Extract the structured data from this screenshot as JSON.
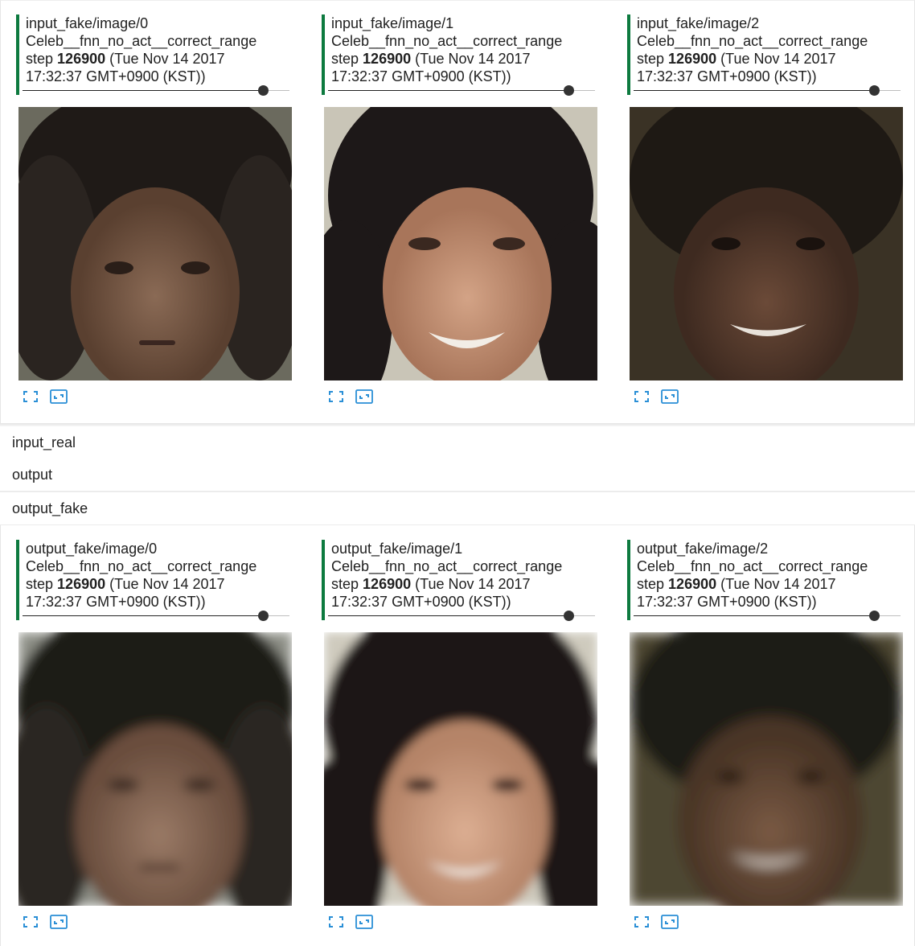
{
  "accent_color": "#0d7a3f",
  "icon_color": "#2a8fd6",
  "sections": {
    "input_fake": {
      "cards": [
        {
          "tag": "input_fake/image/0",
          "run": "Celeb__fnn_no_act__correct_range",
          "step_prefix": "step",
          "step": "126900",
          "time_a": "(Tue Nov 14 2017",
          "time_b": "17:32:37 GMT+0900 (KST))"
        },
        {
          "tag": "input_fake/image/1",
          "run": "Celeb__fnn_no_act__correct_range",
          "step_prefix": "step",
          "step": "126900",
          "time_a": "(Tue Nov 14 2017",
          "time_b": "17:32:37 GMT+0900 (KST))"
        },
        {
          "tag": "input_fake/image/2",
          "run": "Celeb__fnn_no_act__correct_range",
          "step_prefix": "step",
          "step": "126900",
          "time_a": "(Tue Nov 14 2017",
          "time_b": "17:32:37 GMT+0900 (KST))"
        }
      ]
    },
    "collapsed": [
      {
        "label": "input_real"
      },
      {
        "label": "output"
      },
      {
        "label": "output_fake"
      }
    ],
    "output_fake": {
      "cards": [
        {
          "tag": "output_fake/image/0",
          "run": "Celeb__fnn_no_act__correct_range",
          "step_prefix": "step",
          "step": "126900",
          "time_a": "(Tue Nov 14 2017",
          "time_b": "17:32:37 GMT+0900 (KST))"
        },
        {
          "tag": "output_fake/image/1",
          "run": "Celeb__fnn_no_act__correct_range",
          "step_prefix": "step",
          "step": "126900",
          "time_a": "(Tue Nov 14 2017",
          "time_b": "17:32:37 GMT+0900 (KST))"
        },
        {
          "tag": "output_fake/image/2",
          "run": "Celeb__fnn_no_act__correct_range",
          "step_prefix": "step",
          "step": "126900",
          "time_a": "(Tue Nov 14 2017",
          "time_b": "17:32:37 GMT+0900 (KST))"
        }
      ]
    }
  },
  "step_slider_position": 0.9,
  "icons": {
    "expand": "fullscreen-icon",
    "actual_size": "actual-size-icon"
  }
}
